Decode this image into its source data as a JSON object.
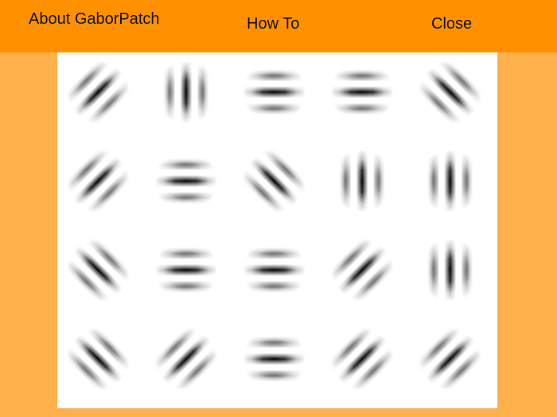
{
  "menu": {
    "about_label": "About  GaborPatch",
    "howto_label": "How To",
    "close_label": "Close"
  },
  "colors": {
    "menu_bar": "#FF9100",
    "background": "#FFB04A",
    "board": "#FFFFFF"
  },
  "board": {
    "rows": 4,
    "cols": 5,
    "patches": [
      [
        {
          "orientation": 45
        },
        {
          "orientation": 90
        },
        {
          "orientation": 0
        },
        {
          "orientation": 0
        },
        {
          "orientation": -45
        }
      ],
      [
        {
          "orientation": 45
        },
        {
          "orientation": 0
        },
        {
          "orientation": -45
        },
        {
          "orientation": 90
        },
        {
          "orientation": 90
        }
      ],
      [
        {
          "orientation": -45
        },
        {
          "orientation": 0
        },
        {
          "orientation": 0
        },
        {
          "orientation": 45
        },
        {
          "orientation": 90
        }
      ],
      [
        {
          "orientation": -45
        },
        {
          "orientation": 45
        },
        {
          "orientation": 0
        },
        {
          "orientation": 45
        },
        {
          "orientation": 45
        }
      ]
    ]
  }
}
